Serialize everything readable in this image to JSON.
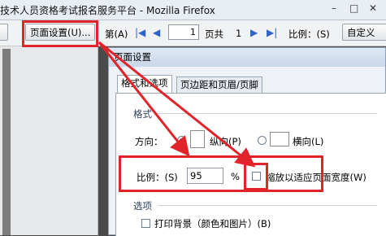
{
  "window": {
    "title": "技术人员资格考试报名服务平台 - Mozilla Firefox",
    "controls": [
      "–",
      "□",
      "✕"
    ]
  },
  "toolbar": {
    "page_setup": "页面设置(U)...",
    "page_prefix": "第(A)",
    "page_value": "1",
    "page_of": "页共",
    "page_total": "1",
    "scale_label": "比例：(S)",
    "scale_value": "自定义"
  },
  "dialog": {
    "title": "页面设置",
    "tabs": [
      "格式和选项",
      "页边距和页眉/页脚"
    ],
    "format_section": "格式",
    "orientation_label": "方向：",
    "portrait": "纵向(P)",
    "landscape": "横向(L)",
    "scale_label": "比例：(S)",
    "scale_value": "95",
    "percent": "%",
    "shrink_to_fit": "缩放以适应页面宽度(W)",
    "options_section": "选项",
    "print_background": "打印背景（颜色和图片）(B)"
  },
  "icons": {
    "nav_first": "first-page-icon",
    "nav_prev": "prev-page-icon",
    "nav_next": "next-page-icon",
    "nav_last": "last-page-icon"
  },
  "colors": {
    "highlight": "#e0242a"
  }
}
